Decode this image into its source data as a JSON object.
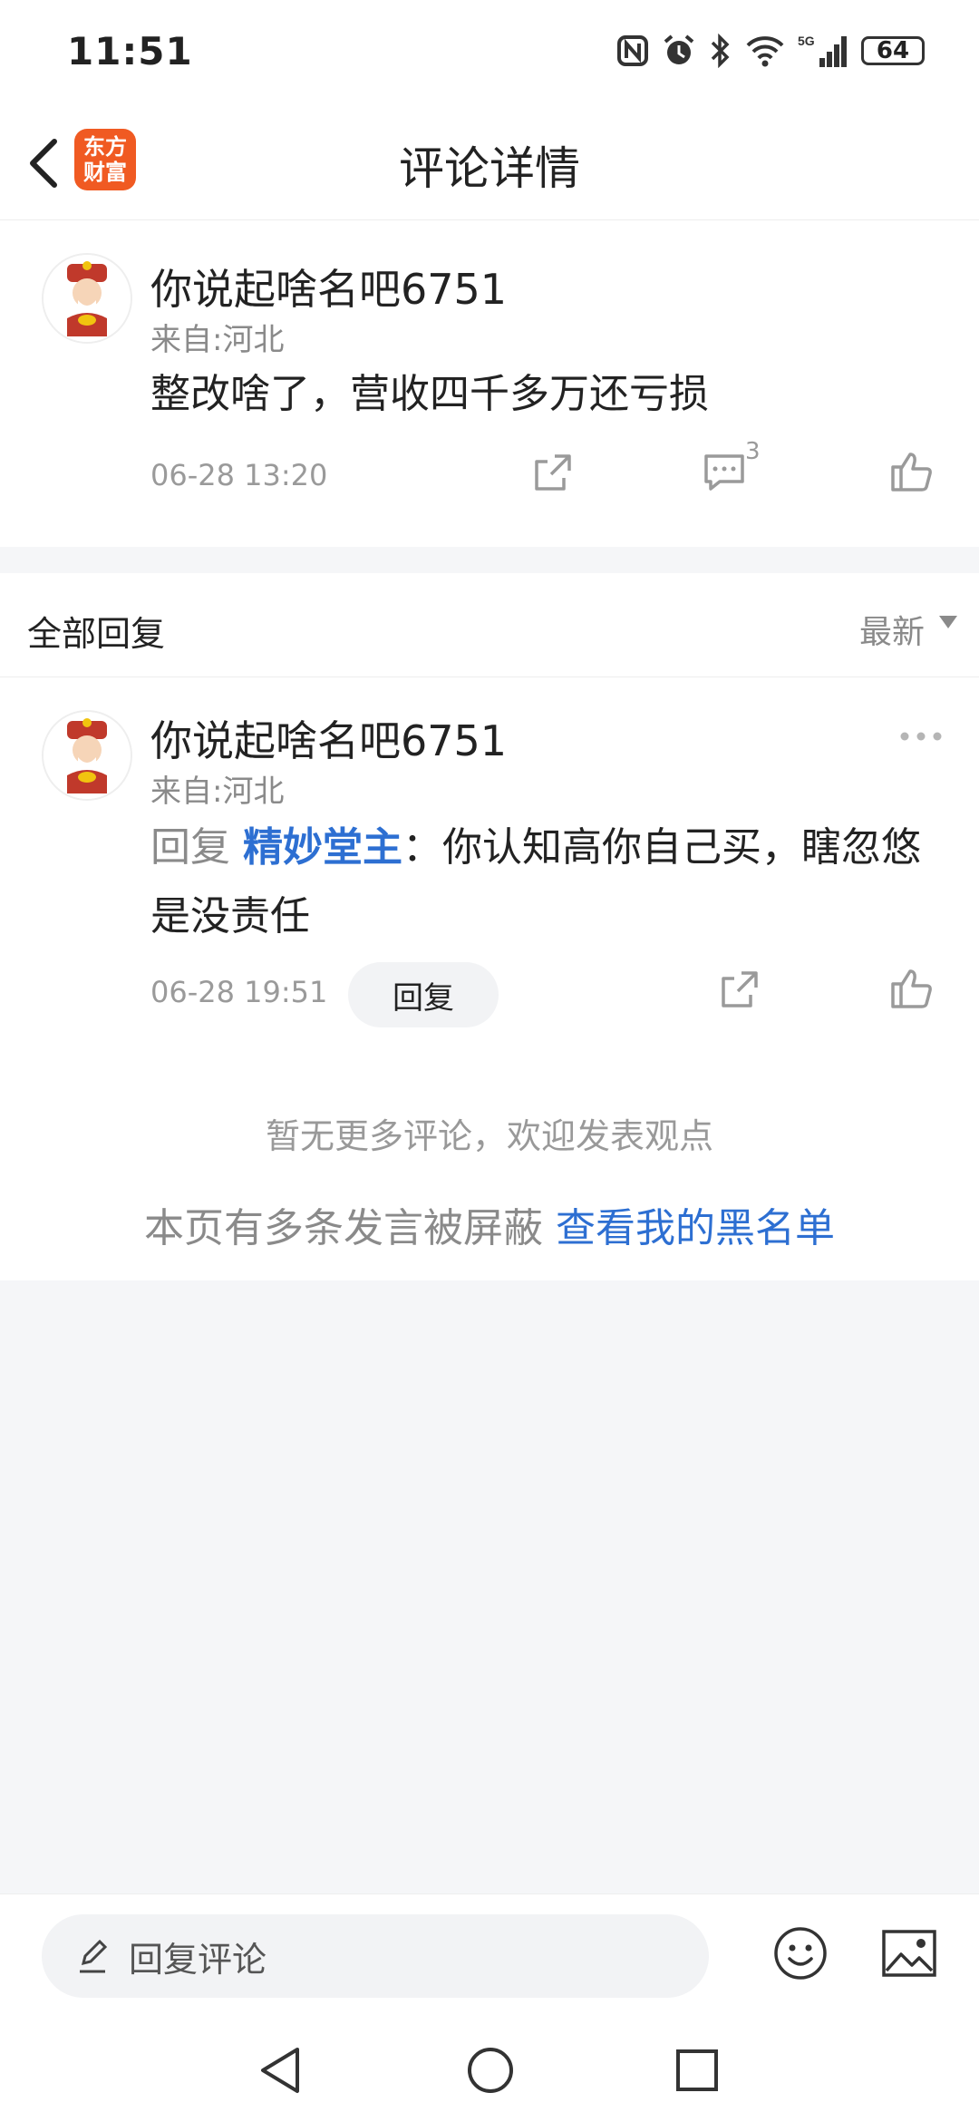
{
  "status": {
    "time": "11:51",
    "battery": "64",
    "network": "5G"
  },
  "header": {
    "title": "评论详情",
    "logo_line1": "东方",
    "logo_line2": "财富"
  },
  "comment": {
    "username": "你说起啥名吧6751",
    "location": "来自:河北",
    "content": "整改啥了，营收四千多万还亏损",
    "time": "06-28 13:20",
    "reply_count": "3"
  },
  "replies_section": {
    "title": "全部回复",
    "sort": "最新"
  },
  "reply": {
    "username": "你说起啥名吧6751",
    "location": "来自:河北",
    "prefix": "回复",
    "target": "精妙堂主",
    "separator": "：",
    "content_line1": "你认知高你自己买，瞎忽悠",
    "content_line2": "是没责任",
    "time": "06-28 19:51",
    "reply_button": "回复"
  },
  "footer": {
    "no_more": "暂无更多评论，欢迎发表观点",
    "blocked_notice": "本页有多条发言被屏蔽",
    "blacklist_link": "查看我的黑名单"
  },
  "bottom_bar": {
    "placeholder": "回复评论"
  },
  "colors": {
    "link": "#2d6fd2",
    "logo": "#f05a22",
    "background": "#f5f6f8"
  }
}
